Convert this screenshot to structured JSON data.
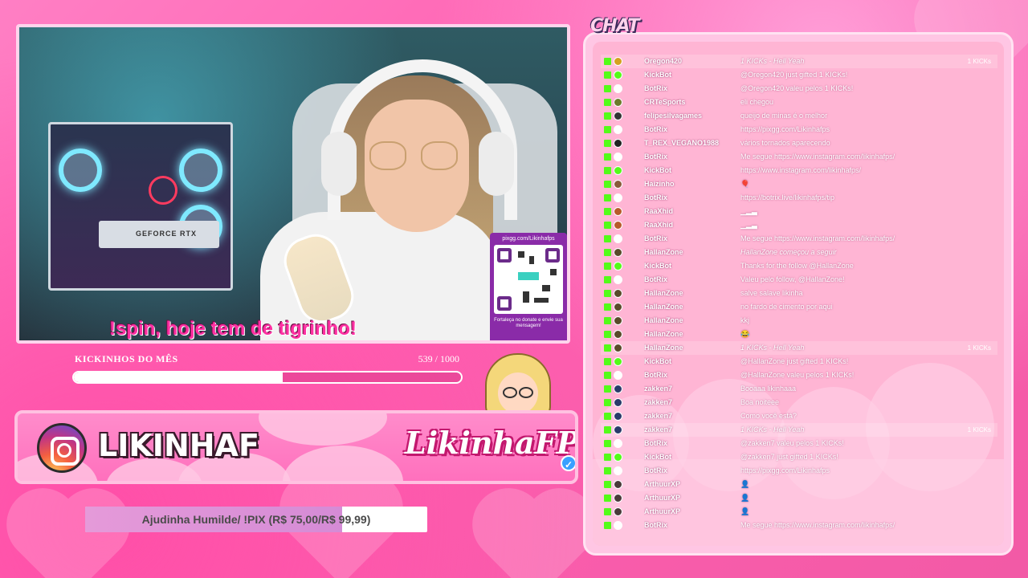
{
  "webcam": {
    "caption": "!spin, hoje tem de tigrinho!",
    "gpu_label": "GEFORCE RTX",
    "qr": {
      "url": "pixgg.com/Likinhafps",
      "note": "Fortaleça no donate e envie sua mensagem!"
    }
  },
  "goal": {
    "title": "KICKINHOS DO MÊS",
    "current": "539",
    "total": "1000",
    "progress": 0.539
  },
  "banner": {
    "handle": "LIKINHAF",
    "brand": "LikinhaFPS",
    "verified": "✓"
  },
  "donation": {
    "text": "Ajudinha Humilde/ !PIX (R$ 75,00/R$ 99,99)",
    "progress": 0.75
  },
  "chat": {
    "title": "CHAT",
    "rows": [
      {
        "user": "Oregon420",
        "msg": "1 KICKs - Hell Yeah",
        "kick": "1 KICKs",
        "hl": true,
        "it": true,
        "color": "#d4a11e"
      },
      {
        "user": "KickBot",
        "msg": "@Oregon420 just gifted 1 KICKs!",
        "kick": "",
        "hl": false,
        "it": false,
        "color": "#53fc18"
      },
      {
        "user": "BotRix",
        "msg": "@Oregon420 valeu pelos 1 KICKs!",
        "kick": "",
        "hl": false,
        "it": false,
        "color": "#ffffff"
      },
      {
        "user": "CRTeSports",
        "msg": "eli chegou",
        "kick": "",
        "hl": false,
        "it": false,
        "color": "#6d7a2b"
      },
      {
        "user": "felipesilvagames",
        "msg": "queijo de minas é o melhor",
        "kick": "",
        "hl": false,
        "it": false,
        "color": "#333333"
      },
      {
        "user": "BotRix",
        "msg": "https://pixgg.com/Likinhafps",
        "kick": "",
        "hl": false,
        "it": false,
        "color": "#ffffff"
      },
      {
        "user": "T_REX_VEGANO1988",
        "msg": "vários tornados aparecendo",
        "kick": "",
        "hl": false,
        "it": false,
        "color": "#222222"
      },
      {
        "user": "BotRix",
        "msg": "Me segue https://www.instagram.com/likinhafps/",
        "kick": "",
        "hl": false,
        "it": false,
        "color": "#ffffff"
      },
      {
        "user": "KickBot",
        "msg": "https://www.instagram.com/likinhafps/",
        "kick": "",
        "hl": false,
        "it": false,
        "color": "#53fc18"
      },
      {
        "user": "Haizinho",
        "msg": "🎈",
        "kick": "",
        "hl": false,
        "it": false,
        "color": "#8a5a3a"
      },
      {
        "user": "BotRix",
        "msg": "https://botrix.live/likinhafps/tip",
        "kick": "",
        "hl": false,
        "it": false,
        "color": "#ffffff"
      },
      {
        "user": "RaaXhid",
        "msg": "▁▂▃",
        "kick": "",
        "hl": false,
        "it": false,
        "color": "#b85a2a"
      },
      {
        "user": "RaaXhid",
        "msg": "▁▂▃",
        "kick": "",
        "hl": false,
        "it": false,
        "color": "#b85a2a"
      },
      {
        "user": "BotRix",
        "msg": "Me segue https://www.instagram.com/likinhafps/",
        "kick": "",
        "hl": false,
        "it": false,
        "color": "#ffffff"
      },
      {
        "user": "HallanZone",
        "msg": "HallanZone começou a seguir",
        "kick": "",
        "hl": false,
        "it": true,
        "color": "#5a4a2a"
      },
      {
        "user": "KickBot",
        "msg": "Thanks for the follow @HallanZone",
        "kick": "",
        "hl": false,
        "it": false,
        "color": "#53fc18"
      },
      {
        "user": "BotRix",
        "msg": "Valeu pelo follow, @HallanZone!",
        "kick": "",
        "hl": false,
        "it": false,
        "color": "#ffffff"
      },
      {
        "user": "HallanZone",
        "msg": "salve salave likinha",
        "kick": "",
        "hl": false,
        "it": false,
        "color": "#5a4a2a"
      },
      {
        "user": "HallanZone",
        "msg": "no fardo de cimento por aqui",
        "kick": "",
        "hl": false,
        "it": false,
        "color": "#5a4a2a"
      },
      {
        "user": "HallanZone",
        "msg": "kkj",
        "kick": "",
        "hl": false,
        "it": false,
        "color": "#5a4a2a"
      },
      {
        "user": "HallanZone",
        "msg": "😂",
        "kick": "",
        "hl": false,
        "it": false,
        "color": "#5a4a2a"
      },
      {
        "user": "HallanZone",
        "msg": "1 KICKs - Hell Yeah",
        "kick": "1 KICKs",
        "hl": true,
        "it": true,
        "color": "#5a4a2a"
      },
      {
        "user": "KickBot",
        "msg": "@HallanZone just gifted 1 KICKs!",
        "kick": "",
        "hl": false,
        "it": false,
        "color": "#53fc18"
      },
      {
        "user": "BotRix",
        "msg": "@HallanZone valeu pelos 1 KICKs!",
        "kick": "",
        "hl": false,
        "it": false,
        "color": "#ffffff"
      },
      {
        "user": "zakken7",
        "msg": "Booaaa likinhaaa",
        "kick": "",
        "hl": false,
        "it": false,
        "color": "#2a3a6a"
      },
      {
        "user": "zakken7",
        "msg": "Boa noiteee",
        "kick": "",
        "hl": false,
        "it": false,
        "color": "#2a3a6a"
      },
      {
        "user": "zakken7",
        "msg": "Como você está?",
        "kick": "",
        "hl": false,
        "it": false,
        "color": "#2a3a6a"
      },
      {
        "user": "zakken7",
        "msg": "1 KICKs - Hell Yeah",
        "kick": "1 KICKs",
        "hl": true,
        "it": true,
        "color": "#2a3a6a"
      },
      {
        "user": "BotRix",
        "msg": "@zakken7 valeu pelos 1 KICKs!",
        "kick": "",
        "hl": false,
        "it": false,
        "color": "#ffffff"
      },
      {
        "user": "KickBot",
        "msg": "@zakken7 just gifted 1 KICKs!",
        "kick": "",
        "hl": false,
        "it": false,
        "color": "#53fc18"
      },
      {
        "user": "BotRix",
        "msg": "https://pixgg.com/Likinhafps",
        "kick": "",
        "hl": false,
        "it": false,
        "color": "#ffffff"
      },
      {
        "user": "ArthuurXP",
        "msg": "👤",
        "kick": "",
        "hl": false,
        "it": false,
        "color": "#4a3a3a"
      },
      {
        "user": "ArthuurXP",
        "msg": "👤",
        "kick": "",
        "hl": false,
        "it": false,
        "color": "#4a3a3a"
      },
      {
        "user": "ArthuurXP",
        "msg": "👤",
        "kick": "",
        "hl": false,
        "it": false,
        "color": "#4a3a3a"
      },
      {
        "user": "BotRix",
        "msg": "Me segue https://www.instagram.com/likinhafps/",
        "kick": "",
        "hl": false,
        "it": false,
        "color": "#ffffff"
      }
    ]
  }
}
